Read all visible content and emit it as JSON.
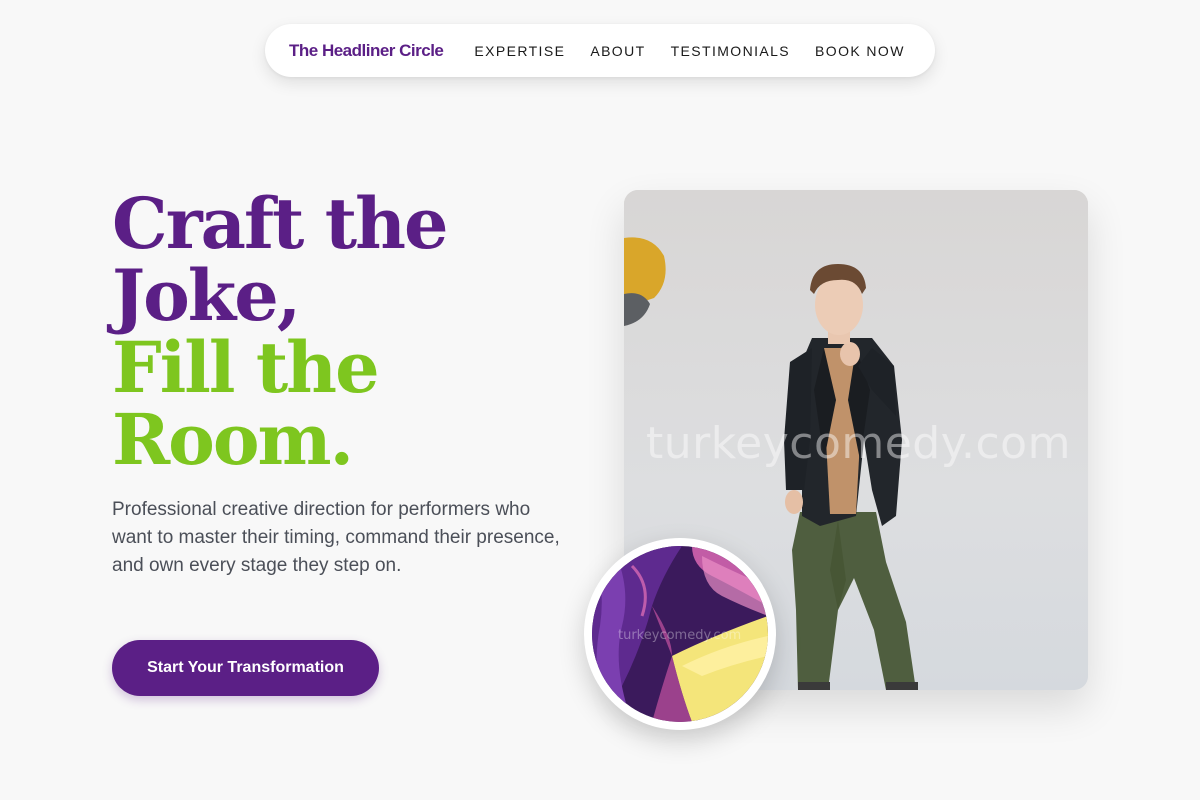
{
  "nav": {
    "brand": "The Headliner Circle",
    "links": [
      "EXPERTISE",
      "ABOUT",
      "TESTIMONIALS",
      "BOOK NOW"
    ]
  },
  "hero": {
    "headline_line1": "Craft the",
    "headline_line2": "Joke,",
    "headline_line3": "Fill the",
    "headline_line4": "Room.",
    "subtext": "Professional creative direction for performers who want to master their timing, command their presence, and own every stage they step on.",
    "cta_label": "Start Your Transformation"
  },
  "media": {
    "photo_watermark": "turkeycomedy.com",
    "circle_watermark": "turkeycomedy.com"
  },
  "colors": {
    "brand_purple": "#5b1f86",
    "accent_green": "#7ec61f",
    "background": "#f8f8f8"
  }
}
